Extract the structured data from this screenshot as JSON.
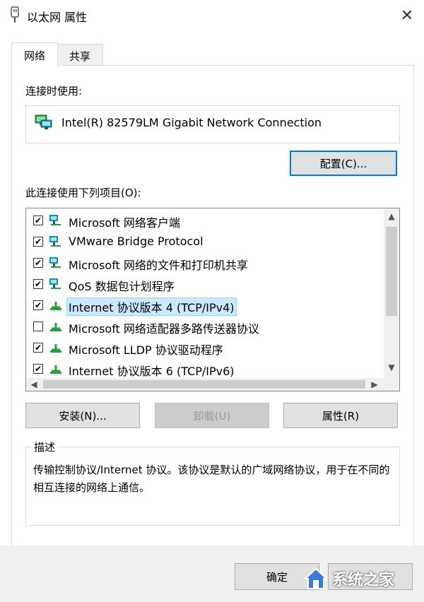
{
  "window": {
    "title": "以太网 属性"
  },
  "tabs": [
    {
      "label": "网络",
      "active": true
    },
    {
      "label": "共享",
      "active": false
    }
  ],
  "connect_using": {
    "label": "连接时使用:",
    "adapter": "Intel(R) 82579LM Gigabit Network Connection",
    "configure_button": "配置(C)..."
  },
  "items_section": {
    "label": "此连接使用下列项目(O):",
    "items": [
      {
        "label": "Microsoft 网络客户端",
        "checked": true,
        "icon": "network-client-icon"
      },
      {
        "label": "VMware Bridge Protocol",
        "checked": true,
        "icon": "network-service-icon"
      },
      {
        "label": "Microsoft 网络的文件和打印机共享",
        "checked": true,
        "icon": "network-service-icon"
      },
      {
        "label": "QoS 数据包计划程序",
        "checked": true,
        "icon": "network-service-icon"
      },
      {
        "label": "Internet 协议版本 4 (TCP/IPv4)",
        "checked": true,
        "selected": true,
        "icon": "protocol-icon"
      },
      {
        "label": "Microsoft 网络适配器多路传送器协议",
        "checked": false,
        "icon": "protocol-icon"
      },
      {
        "label": "Microsoft LLDP 协议驱动程序",
        "checked": true,
        "icon": "protocol-icon"
      },
      {
        "label": "Internet 协议版本 6 (TCP/IPv6)",
        "checked": true,
        "icon": "protocol-icon"
      }
    ],
    "scroll_position": 0
  },
  "buttons": {
    "install": "安装(N)...",
    "uninstall": "卸载(U)",
    "properties": "属性(R)"
  },
  "description": {
    "title": "描述",
    "text": "传输控制协议/Internet 协议。该协议是默认的广域网络协议，用于在不同的相互连接的网络上通信。"
  },
  "footer": {
    "ok": "确定",
    "watermark": "系统之家"
  },
  "colors": {
    "accent": "#0078d7",
    "selection": "#cce8ff",
    "icon_green": "#2e9a48",
    "icon_teal": "#1e8fa6"
  }
}
